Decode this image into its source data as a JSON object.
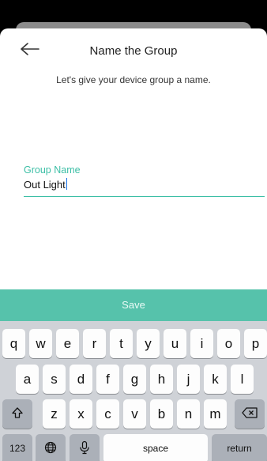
{
  "header": {
    "title": "Name the Group",
    "back_icon": "arrow-left-icon"
  },
  "subtitle": "Let's give your device group a name.",
  "field": {
    "label": "Group Name",
    "value": "Out Light",
    "accent": "#3dbfa6"
  },
  "save_button": {
    "label": "Save",
    "color": "#56c2ab"
  },
  "keyboard": {
    "row1": [
      "q",
      "w",
      "e",
      "r",
      "t",
      "y",
      "u",
      "i",
      "o",
      "p"
    ],
    "row2": [
      "a",
      "s",
      "d",
      "f",
      "g",
      "h",
      "j",
      "k",
      "l"
    ],
    "row3": [
      "z",
      "x",
      "c",
      "v",
      "b",
      "n",
      "m"
    ],
    "shift_icon": "shift-icon",
    "delete_icon": "backspace-icon",
    "numbers_label": "123",
    "globe_icon": "globe-icon",
    "mic_icon": "microphone-icon",
    "space_label": "space",
    "return_label": "return"
  }
}
